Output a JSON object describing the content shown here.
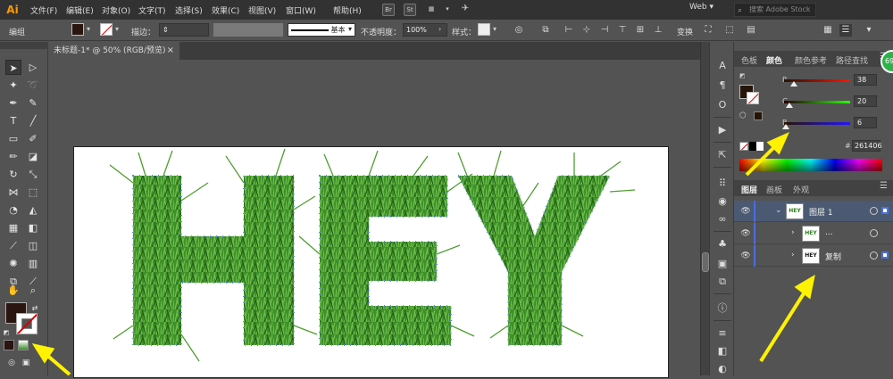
{
  "app": {
    "logo": "Ai"
  },
  "menu": {
    "items": [
      "文件(F)",
      "编辑(E)",
      "对象(O)",
      "文字(T)",
      "选择(S)",
      "效果(C)",
      "视图(V)",
      "窗口(W)",
      "帮助(H)"
    ],
    "bridge_label": "Br",
    "stock_label": "St",
    "workspace": "Web",
    "search_placeholder": "搜索 Adobe Stock"
  },
  "control_bar": {
    "selection_label": "编组",
    "stroke_label": "描边：",
    "brush_style": "基本",
    "opacity_label": "不透明度：",
    "opacity_value": "100%",
    "style_label": "样式：",
    "transform_label": "变换"
  },
  "document": {
    "tab_title": "未标题-1* @ 50% (RGB/预览)",
    "close_glyph": "×"
  },
  "color_panel": {
    "tabs": [
      "色板",
      "颜色",
      "颜色参考",
      "路径查找"
    ],
    "active_tab": "颜色",
    "r_label": "R",
    "r_value": "38",
    "g_label": "G",
    "g_value": "20",
    "b_label": "B",
    "b_value": "6",
    "hex_label": "#",
    "hex_value": "261406",
    "fill_color": "#261406",
    "r_fraction": 0.149,
    "g_fraction": 0.078,
    "b_fraction": 0.024
  },
  "layers_panel": {
    "tabs": [
      "图层",
      "画板",
      "外观"
    ],
    "active_tab": "图层",
    "rows": [
      {
        "name": "图层 1",
        "thumb": "HEY"
      },
      {
        "name": "...",
        "thumb": "HEY"
      },
      {
        "name": "复制",
        "thumb": "HEY"
      }
    ]
  },
  "artwork": {
    "text": "HEY",
    "grass_color": "#3f8f2a"
  },
  "badge": {
    "label": "69"
  }
}
